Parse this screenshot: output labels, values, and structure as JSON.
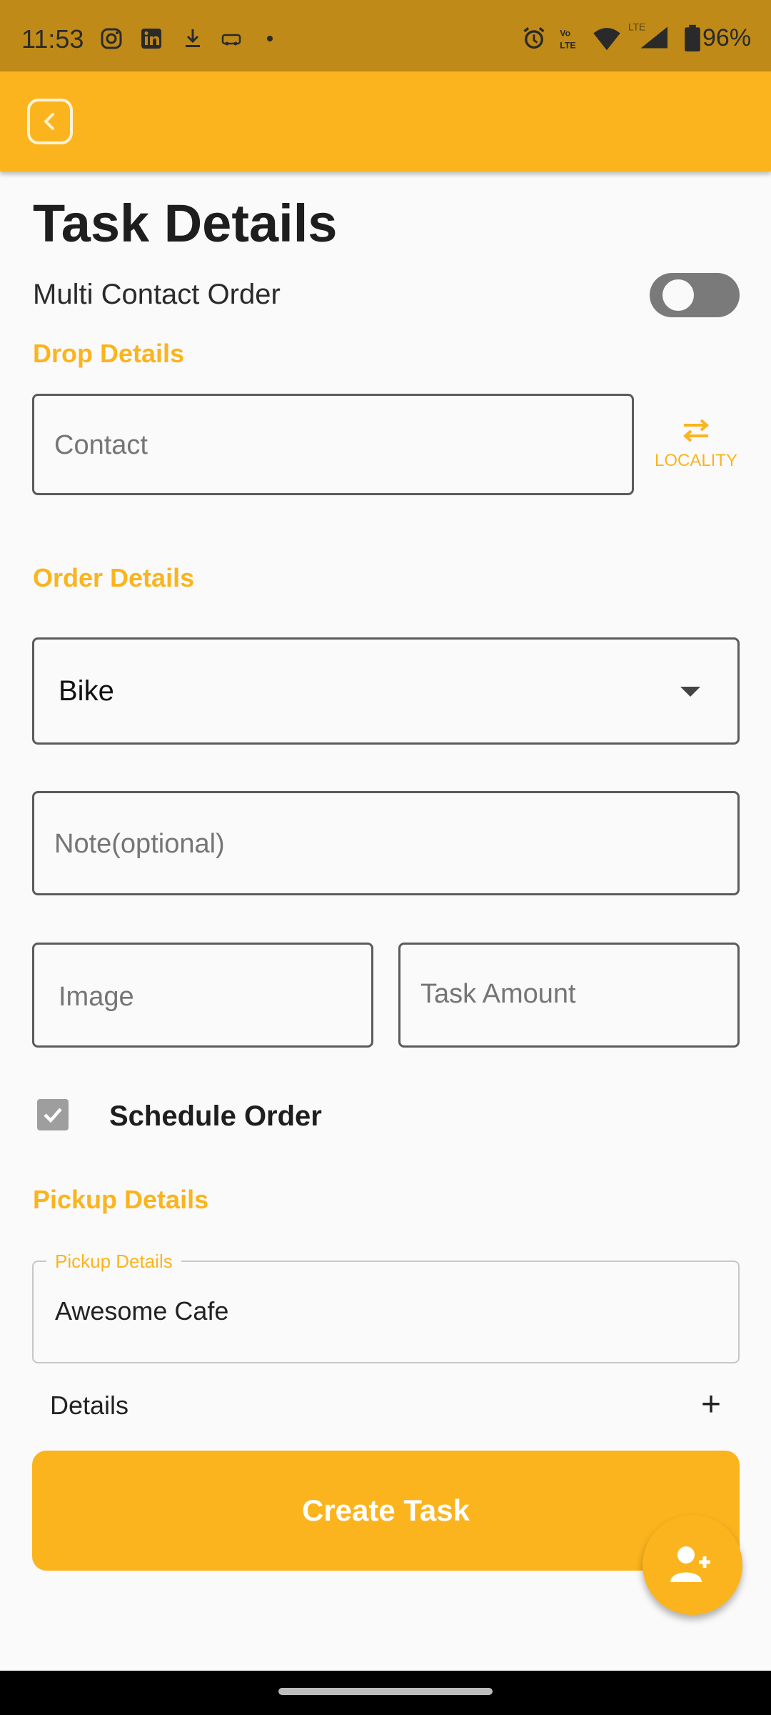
{
  "status_bar": {
    "time": "11:53",
    "battery": "96%",
    "network": "LTE",
    "volte": "Vo LTE",
    "left_icons": [
      "instagram-icon",
      "linkedin-icon",
      "download-icon",
      "car-icon",
      "dot-icon"
    ],
    "right_icons": [
      "alarm-icon",
      "volte-icon",
      "wifi-icon",
      "signal-icon",
      "battery-icon"
    ]
  },
  "app_bar": {
    "back_icon": "chevron-left-icon"
  },
  "page": {
    "title": "Task Details",
    "multi_contact": {
      "label": "Multi Contact Order",
      "enabled": false
    }
  },
  "drop_details": {
    "heading": "Drop Details",
    "contact_placeholder": "Contact",
    "locality": {
      "label": "LOCALITY",
      "icon": "swap-arrows-icon"
    }
  },
  "order_details": {
    "heading": "Order Details",
    "vehicle_selected": "Bike",
    "note_placeholder": "Note(optional)",
    "image_placeholder": "Image",
    "amount_placeholder": "Task Amount"
  },
  "schedule": {
    "label": "Schedule Order",
    "checked": true
  },
  "pickup": {
    "heading": "Pickup Details",
    "field_label": "Pickup Details",
    "value": "Awesome Cafe",
    "details_label": "Details",
    "details_icon": "plus-icon"
  },
  "actions": {
    "create_label": "Create Task",
    "fab_icon": "add-person-icon"
  },
  "colors": {
    "accent": "#fbb41e",
    "status_bar": "#bf8a18",
    "text": "#212121"
  }
}
